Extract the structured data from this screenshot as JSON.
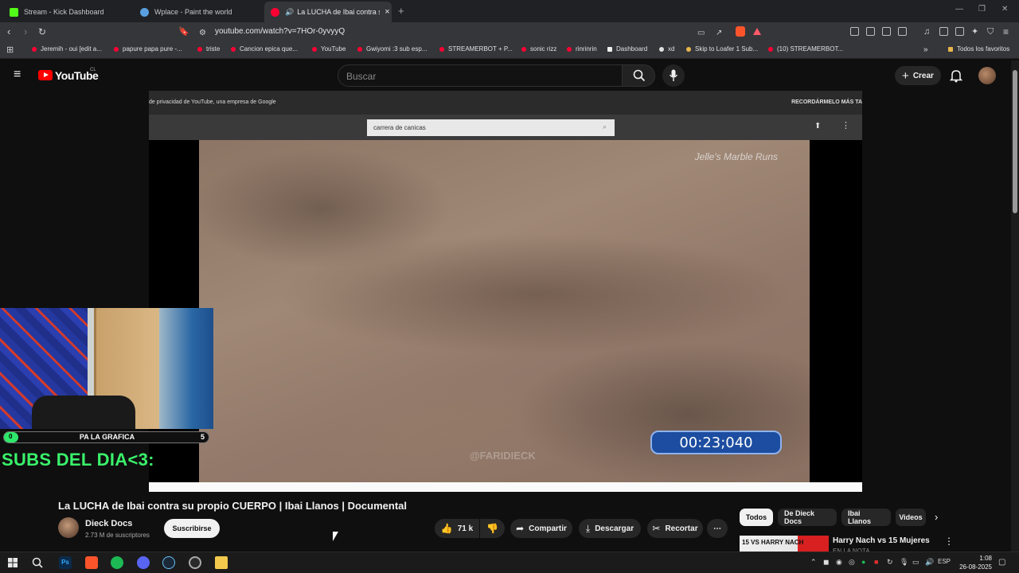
{
  "browser": {
    "tabs": [
      {
        "label": "Stream - Kick Dashboard",
        "favicon_color": "#53fc18"
      },
      {
        "label": "Wplace - Paint the world",
        "favicon_color": "#5aa0e0"
      },
      {
        "label": "La LUCHA de Ibai contra su p",
        "favicon_color": "#ff0033"
      }
    ],
    "tab_close": "×",
    "new_tab": "+",
    "url": "youtube.com/watch?v=7HOr-0yvyyQ",
    "bookmarks": [
      {
        "label": "Jeremih - oui [edit a..."
      },
      {
        "label": "papure papa pure -..."
      },
      {
        "label": "triste"
      },
      {
        "label": "Cancion epica que..."
      },
      {
        "label": "YouTube"
      },
      {
        "label": "Gwiyomi :3 sub esp..."
      },
      {
        "label": "STREAMERBOT + P..."
      },
      {
        "label": "sonic rizz"
      },
      {
        "label": "rinrinrin"
      },
      {
        "label": "Dashboard"
      },
      {
        "label": "xd"
      },
      {
        "label": "Skip to Loafer 1 Sub..."
      },
      {
        "label": "(10) STREAMERBOT..."
      }
    ],
    "bookmarks_more": "»",
    "all_bookmarks": "Todos los favoritos"
  },
  "youtube": {
    "logo_text": "YouTube",
    "region": "CL",
    "search_placeholder": "Buscar",
    "create_label": "Crear"
  },
  "player": {
    "inner_top_left": "de privacidad de YouTube, una empresa de Google",
    "inner_top_right": "RECORDÁRMELO MÁS TA",
    "inner_search": "carrera de canicas",
    "watermark_top": "Jelle's Marble Runs",
    "watermark_bottom": "@FARIDIECK",
    "timer": "00:23;040"
  },
  "overlay": {
    "goal_start": "0",
    "goal_label": "PA LA GRAFICA",
    "goal_end": "5",
    "goal_progress": 0.0,
    "subs_title": "SUBS DEL DIA<3:"
  },
  "video": {
    "title": "La LUCHA de Ibai contra su propio CUERPO | Ibai Llanos | Documental",
    "channel_name": "Dieck Docs",
    "subscribers": "2.73 M de suscriptores",
    "subscribe_label": "Suscribirse",
    "likes": "71 k",
    "share_label": "Compartir",
    "download_label": "Descargar",
    "clip_label": "Recortar",
    "more_label": "⋯"
  },
  "chips": [
    "Todos",
    "De Dieck Docs",
    "Ibai Llanos",
    "Videos"
  ],
  "recommendation": {
    "thumb_text": "15 VS HARRY NACH",
    "title": "Harry Nach vs 15 Mujeres",
    "subtitle": "EN LA NOTA"
  },
  "taskbar": {
    "language": "ESP",
    "time": "1:08",
    "date": "26-08-2025"
  },
  "colors": {
    "accent_red": "#ff0000",
    "goal_green": "#2ee86a",
    "timer_blue": "#1c4da0"
  }
}
